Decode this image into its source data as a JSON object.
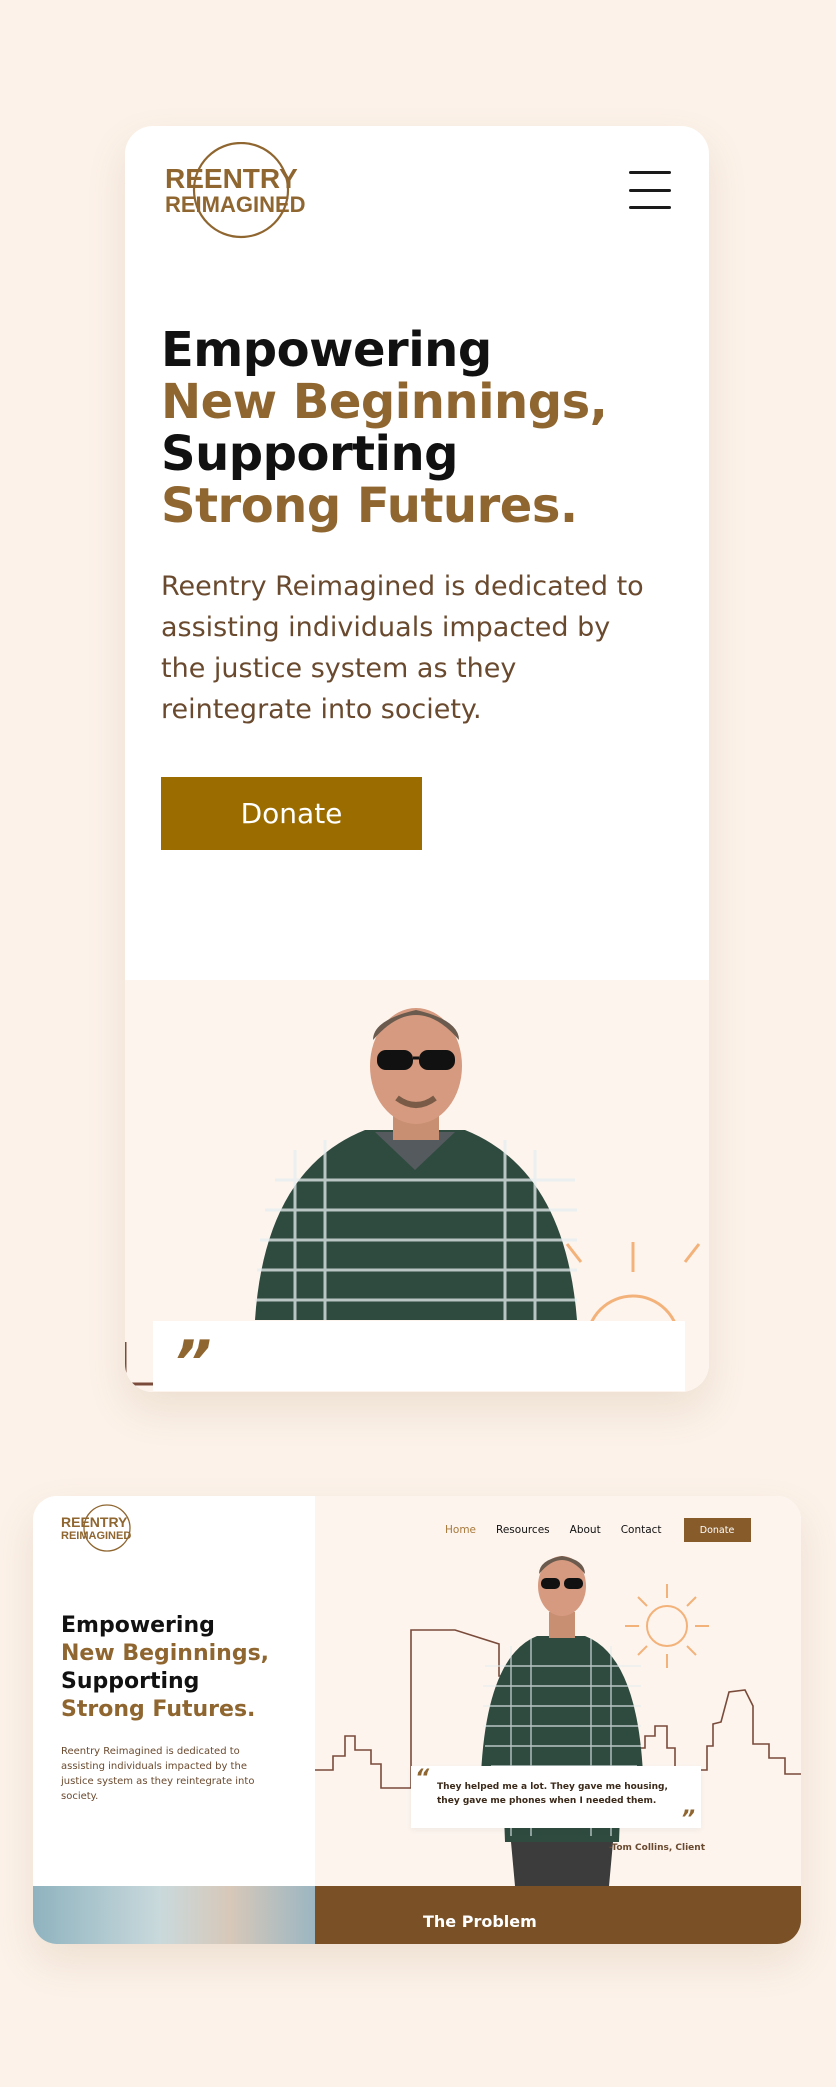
{
  "brand": {
    "logo_line1": "REENTRY",
    "logo_line2": "REIMAGINED",
    "primary_color": "#8f6630",
    "button_color": "#9b6c00",
    "background": "#fcf2e9"
  },
  "mobile": {
    "menu_icon": "hamburger-menu-icon",
    "hero": {
      "line1": "Empowering",
      "line2": "New Beginnings,",
      "line3": "Supporting",
      "line4": "Strong Futures.",
      "description": "Reentry Reimagined is dedicated to assisting individuals impacted by the justice system as they reintegrate into society.",
      "donate_label": "Donate"
    },
    "quote_mark": "”"
  },
  "desktop": {
    "nav": {
      "items": [
        "Home",
        "Resources",
        "About",
        "Contact"
      ],
      "active": "Home",
      "donate_label": "Donate"
    },
    "hero": {
      "line1": "Empowering",
      "line2": "New Beginnings,",
      "line3": "Supporting",
      "line4": "Strong Futures.",
      "description": "Reentry Reimagined is dedicated to assisting individuals impacted by the justice system as they reintegrate into society."
    },
    "testimonial": {
      "open_mark": "“",
      "close_mark": "”",
      "quote": "They helped me a lot. They gave me housing, they gave me phones when I needed them.",
      "author": "-Tom Collins, Client"
    },
    "section_title": "The Problem"
  }
}
